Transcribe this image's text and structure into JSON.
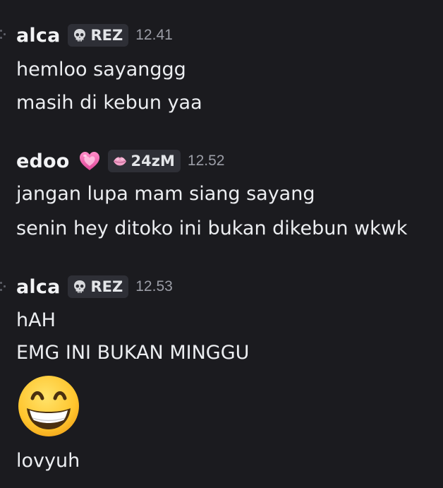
{
  "messages": [
    {
      "username": "alca",
      "tag": {
        "label": "REZ",
        "icon": "skull-icon"
      },
      "timestamp": "12.41",
      "lines": [
        "hemloo sayanggg",
        "masih di kebun yaa"
      ]
    },
    {
      "username": "edoo",
      "username_emoji": "pink-heart-icon",
      "tag": {
        "label": "24zM",
        "icon": "pink-lips-icon"
      },
      "timestamp": "12.52",
      "lines": [
        "jangan lupa mam siang sayang",
        "senin hey ditoko ini bukan dikebun wkwk"
      ]
    },
    {
      "username": "alca",
      "tag": {
        "label": "REZ",
        "icon": "skull-icon"
      },
      "timestamp": "12.53",
      "lines": [
        "hAH",
        "EMG INI BUKAN MINGGU"
      ],
      "emoji": "grinning-face-icon",
      "after_emoji": "lovyuh"
    }
  ],
  "colors": {
    "background": "#1b1b1f",
    "username": "#f2f3f5",
    "tag_background": "#2e2f36",
    "timestamp": "#9b9da6",
    "text": "#eceef1"
  }
}
